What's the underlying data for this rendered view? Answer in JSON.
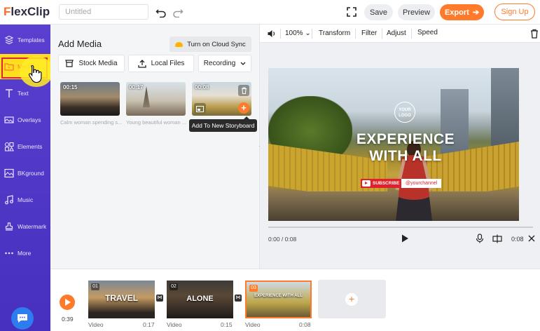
{
  "app": {
    "logo_prefix": "F",
    "logo_rest": "lexClip"
  },
  "header": {
    "title_placeholder": "Untitled",
    "save": "Save",
    "preview": "Preview",
    "export": "Export",
    "signup": "Sign Up",
    "accent_color": "#ff7a2b"
  },
  "sidebar": {
    "items": [
      {
        "label": "Templates",
        "icon": "templates-icon"
      },
      {
        "label": "Media",
        "icon": "media-folder-icon",
        "active": true
      },
      {
        "label": "Text",
        "icon": "text-icon"
      },
      {
        "label": "Overlays",
        "icon": "overlays-icon"
      },
      {
        "label": "Elements",
        "icon": "elements-icon"
      },
      {
        "label": "BKground",
        "icon": "background-icon"
      },
      {
        "label": "Music",
        "icon": "music-icon"
      },
      {
        "label": "Watermark",
        "icon": "watermark-icon"
      },
      {
        "label": "More",
        "icon": "more-icon"
      }
    ]
  },
  "media_panel": {
    "title": "Add Media",
    "cloud_sync": "Turn on Cloud Sync",
    "tabs": {
      "stock": "Stock Media",
      "local": "Local Files",
      "recording": "Recording"
    },
    "thumbs": [
      {
        "duration": "00:15",
        "caption": "Calm woman spending s..."
      },
      {
        "duration": "00:17",
        "caption": "Young beautiful woman ..."
      },
      {
        "duration": "00:08",
        "caption": ""
      }
    ],
    "tooltip": "Add To New Storyboard"
  },
  "editor": {
    "zoom": "100%",
    "tools": {
      "transform": "Transform",
      "filter": "Filter",
      "adjust": "Adjust",
      "speed": "Speed"
    },
    "canvas": {
      "logo_text_1": "YOUR",
      "logo_text_2": "LOGO",
      "headline_1": "EXPERIENCE",
      "headline_2": "WITH ALL",
      "subscribe": "SUBSCRIBE",
      "channel": "@yourchannel"
    },
    "time_current": "0:00 / 0:08",
    "time_end": "0:08"
  },
  "timeline": {
    "time": "0:39",
    "clips": [
      {
        "index": "01",
        "word": "TRAVEL",
        "type": "Video",
        "duration": "0:17"
      },
      {
        "index": "02",
        "word": "ALONE",
        "type": "Video",
        "duration": "0:15"
      },
      {
        "index": "03",
        "word": "EXPERIENCE WITH ALL",
        "type": "Video",
        "duration": "0:08"
      }
    ]
  }
}
